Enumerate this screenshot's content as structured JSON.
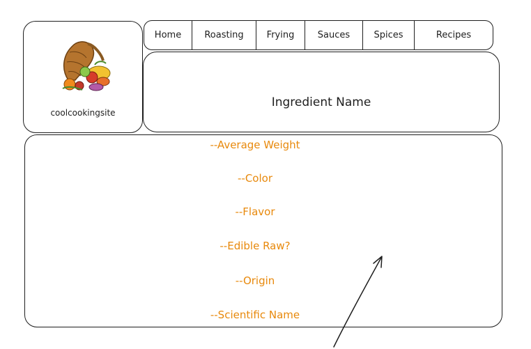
{
  "logo": {
    "site_name": "coolcookingsite",
    "image_icon": "cornucopia-icon"
  },
  "nav": {
    "items": [
      {
        "label": "Home"
      },
      {
        "label": "Roasting"
      },
      {
        "label": "Frying"
      },
      {
        "label": "Sauces"
      },
      {
        "label": "Spices"
      },
      {
        "label": "Recipes"
      }
    ]
  },
  "header": {
    "title": "Ingredient Name"
  },
  "details": {
    "fields": [
      {
        "label": "--Average Weight"
      },
      {
        "label": "--Color"
      },
      {
        "label": "--Flavor"
      },
      {
        "label": "--Edible Raw?"
      },
      {
        "label": "--Origin"
      },
      {
        "label": "--Scientific Name"
      }
    ]
  },
  "colors": {
    "stroke": "#1e1e1e",
    "accent": "#e8890c"
  }
}
